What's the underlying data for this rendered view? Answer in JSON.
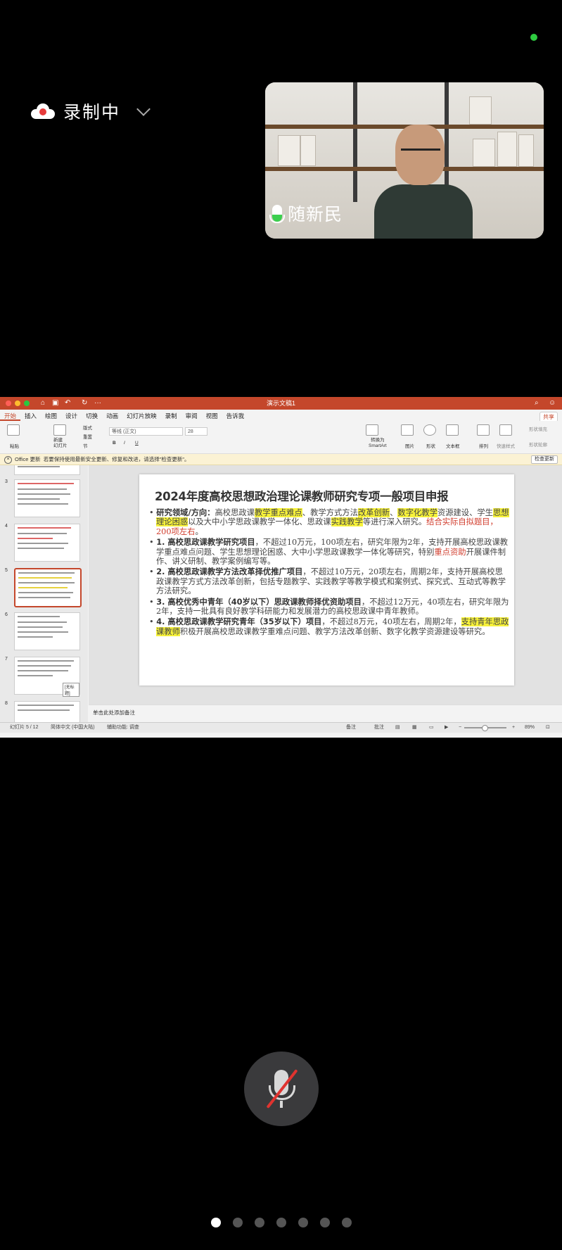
{
  "recording": {
    "label": "录制中"
  },
  "participant": {
    "name": "随新民"
  },
  "app": {
    "window_title": "演示文稿1",
    "menu": [
      "开始",
      "插入",
      "绘图",
      "设计",
      "切换",
      "动画",
      "幻灯片放映",
      "录制",
      "审阅",
      "视图",
      "告诉我"
    ],
    "share_label": "共享",
    "ribbon": {
      "paste": "粘贴",
      "new_slide": "新建\n幻灯片",
      "layout": "版式",
      "reset": "重置",
      "section": "节",
      "font_name": "等线 (正文)",
      "font_size": "28",
      "smartart": "转换为\nSmartArt",
      "picture": "图片",
      "shape": "形状",
      "textbox": "文本框",
      "arrange": "排列",
      "quick_styles": "快速样式",
      "shape_fill": "形状填充",
      "shape_outline": "形状轮廓"
    },
    "notice": {
      "title": "Office 更新",
      "text": "若要保持使用最新安全更新、修复和改进，请选择\"检查更新\"。",
      "button": "检查更新"
    },
    "thumbnails": {
      "numbers": [
        "3",
        "4",
        "5",
        "6",
        "7",
        "8"
      ],
      "no_title_tag": "[无标题]"
    },
    "slide": {
      "title": "2024年度高校思想政治理论课教师研究专项一般项目申报",
      "b1_a": "研究领域/方向：",
      "b1_b": "高校思政课",
      "b1_c": "教学重点难点",
      "b1_d": "、教学方式方法",
      "b1_e": "改革创新",
      "b1_f": "、",
      "b1_g": "数字化教学",
      "b1_h": "资源建设、学生",
      "b1_i": "思想理论困惑",
      "b1_j": "以及大中小学思政课教学一体化、思政课",
      "b1_k": "实践教学",
      "b1_l": "等进行深入研究。",
      "b1_m": "结合实际自拟题目，200项左右",
      "b1_n": "。",
      "b2_head": "1. 高校思政课教学研究项目",
      "b2_a": "，不超过10万元，100项左右，研究年限为2年，支持开展高校思政课教学重点难点问题、学生思想理论困惑、大中小学思政课教学一体化等研究，特别",
      "b2_red": "重点资助",
      "b2_b": "开展课件制作、讲义研制、教学案例编写等。",
      "b3_head": "2. 高校思政课教学方法改革择优推广项目",
      "b3_a": "，不超过10万元，20项左右，周期2年，支持开展高校思政课教学方式方法改革创新，包括专题教学、实践教学等教学模式和案例式、探究式、互动式等教学方法研究。",
      "b4_head": "3. 高校优秀中青年（40岁以下）思政课教师择优资助项目",
      "b4_a": "，不超过12万元，40项左右，研究年限为2年，支持一批具有良好教学科研能力和发展潜力的高校思政课中青年教师。",
      "b5_head": "4. 高校思政课教学研究青年（35岁以下）项目",
      "b5_a": "，不超过8万元，40项左右，周期2年，",
      "b5_hl": "支持青年思政课教师",
      "b5_b": "积极开展高校思政课教学重难点问题、教学方法改革创新、数字化教学资源建设等研究。"
    },
    "notes_placeholder": "单击此处添加备注",
    "status": {
      "slide_count": "幻灯片 5 / 12",
      "language": "简体中文 (中国大陆)",
      "accessibility": "辅助功能: 调查",
      "notes": "备注",
      "comments": "批注",
      "zoom": "89%"
    }
  },
  "pager": {
    "pages": 7,
    "active": 0
  }
}
